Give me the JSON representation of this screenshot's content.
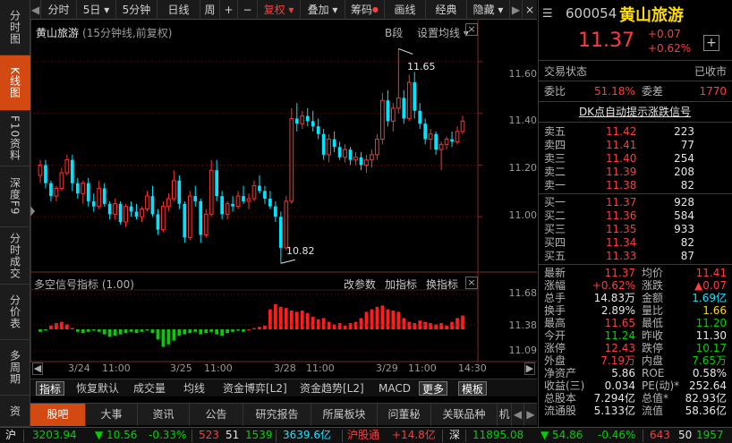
{
  "left_tabs": [
    "分时图",
    "K线图",
    "F10资料",
    "深度F9",
    "分时成交",
    "分价表",
    "多周期",
    "资"
  ],
  "toolbar": {
    "items": [
      "分时",
      "5日 ▾",
      "5分钟",
      "日线",
      "周",
      "+",
      "−",
      "复权 ▾",
      "叠加 ▾",
      "筹码",
      "画线",
      "经典",
      "隐藏 ▾"
    ],
    "nav_left": "◀",
    "nav_right": "▶",
    "close": "×"
  },
  "chart": {
    "title": "黄山旅游",
    "subtitle": "(15分钟线,前复权)",
    "b_label": "B段",
    "ma_label": "设置均线 ▾",
    "price_axis": [
      "11.60",
      "11.40",
      "11.20",
      "11.00"
    ],
    "high_label": "11.65",
    "low_label": "10.82",
    "indicator": "多空信号指标 (1.00)",
    "ind_buttons": [
      "改参数",
      "加指标",
      "换指标"
    ],
    "ind_axis": [
      "11.68",
      "11.38",
      "11.09"
    ],
    "x_labels": [
      "3/24",
      "11:00",
      "3/25",
      "11:00",
      "3/28",
      "11:00",
      "3/29",
      "11:00",
      "14:30"
    ]
  },
  "chart_data": {
    "type": "candlestick",
    "title": "黄山旅游",
    "subtitle": "(15分钟线,前复权)",
    "ylim": [
      10.8,
      11.7
    ],
    "candles": [
      [
        11.16,
        11.22,
        11.13,
        11.2
      ],
      [
        11.2,
        11.22,
        11.11,
        11.13
      ],
      [
        11.13,
        11.14,
        11.06,
        11.08
      ],
      [
        11.08,
        11.12,
        11.06,
        11.11
      ],
      [
        11.11,
        11.19,
        11.1,
        11.17
      ],
      [
        11.17,
        11.24,
        11.16,
        11.22
      ],
      [
        11.22,
        11.24,
        11.1,
        11.13
      ],
      [
        11.13,
        11.15,
        11.07,
        11.09
      ],
      [
        11.09,
        11.14,
        11.05,
        11.13
      ],
      [
        11.13,
        11.15,
        11.04,
        11.06
      ],
      [
        11.06,
        11.09,
        11.02,
        11.04
      ],
      [
        11.04,
        11.14,
        11.03,
        11.11
      ],
      [
        11.11,
        11.13,
        11.04,
        11.05
      ],
      [
        11.05,
        11.06,
        10.99,
        11.01
      ],
      [
        11.01,
        11.07,
        10.99,
        11.05
      ],
      [
        11.05,
        11.06,
        10.97,
        10.98
      ],
      [
        10.98,
        11.05,
        10.96,
        11.04
      ],
      [
        11.04,
        11.06,
        11.0,
        11.02
      ],
      [
        11.02,
        11.05,
        10.99,
        11.0
      ],
      [
        11.0,
        11.04,
        10.98,
        11.03
      ],
      [
        11.03,
        11.1,
        11.02,
        11.08
      ],
      [
        11.08,
        11.12,
        11.0,
        11.01
      ],
      [
        11.01,
        11.03,
        10.93,
        10.95
      ],
      [
        10.95,
        11.06,
        10.94,
        11.04
      ],
      [
        11.04,
        11.09,
        11.02,
        11.07
      ],
      [
        11.07,
        11.18,
        11.06,
        11.14
      ],
      [
        11.14,
        11.16,
        11.03,
        11.05
      ],
      [
        11.05,
        11.06,
        10.9,
        10.92
      ],
      [
        10.92,
        11.1,
        10.91,
        11.08
      ],
      [
        11.08,
        11.12,
        11.04,
        11.06
      ],
      [
        11.06,
        11.07,
        10.9,
        10.93
      ],
      [
        10.93,
        11.03,
        10.92,
        11.01
      ],
      [
        11.01,
        11.22,
        11.0,
        11.18
      ],
      [
        11.18,
        11.22,
        11.06,
        11.08
      ],
      [
        11.08,
        11.1,
        10.99,
        11.01
      ],
      [
        11.01,
        11.06,
        10.99,
        11.05
      ],
      [
        11.05,
        11.08,
        11.02,
        11.04
      ],
      [
        11.04,
        11.1,
        11.03,
        11.08
      ],
      [
        11.08,
        11.12,
        11.05,
        11.06
      ],
      [
        11.06,
        11.09,
        11.03,
        11.07
      ],
      [
        11.07,
        11.14,
        11.06,
        11.12
      ],
      [
        11.12,
        11.16,
        11.09,
        11.1
      ],
      [
        11.1,
        11.12,
        11.05,
        11.07
      ],
      [
        11.07,
        11.1,
        11.03,
        11.04
      ],
      [
        11.04,
        11.06,
        10.98,
        11.0
      ],
      [
        11.0,
        11.02,
        10.82,
        10.88
      ],
      [
        10.88,
        11.08,
        10.87,
        11.06
      ],
      [
        11.06,
        11.42,
        11.05,
        11.38
      ],
      [
        11.38,
        11.44,
        11.33,
        11.36
      ],
      [
        11.36,
        11.41,
        11.34,
        11.39
      ],
      [
        11.39,
        11.42,
        11.35,
        11.37
      ],
      [
        11.37,
        11.41,
        11.33,
        11.35
      ],
      [
        11.35,
        11.38,
        11.3,
        11.32
      ],
      [
        11.32,
        11.34,
        11.22,
        11.24
      ],
      [
        11.24,
        11.32,
        11.21,
        11.3
      ],
      [
        11.3,
        11.33,
        11.25,
        11.27
      ],
      [
        11.27,
        11.29,
        11.22,
        11.23
      ],
      [
        11.23,
        11.28,
        11.21,
        11.26
      ],
      [
        11.26,
        11.27,
        11.2,
        11.22
      ],
      [
        11.22,
        11.25,
        11.2,
        11.23
      ],
      [
        11.23,
        11.25,
        11.18,
        11.2
      ],
      [
        11.2,
        11.24,
        11.17,
        11.22
      ],
      [
        11.22,
        11.26,
        11.19,
        11.24
      ],
      [
        11.24,
        11.32,
        11.22,
        11.3
      ],
      [
        11.3,
        11.48,
        11.28,
        11.45
      ],
      [
        11.45,
        11.49,
        11.35,
        11.37
      ],
      [
        11.37,
        11.44,
        11.33,
        11.42
      ],
      [
        11.42,
        11.65,
        11.4,
        11.46
      ],
      [
        11.46,
        11.49,
        11.36,
        11.38
      ],
      [
        11.38,
        11.55,
        11.37,
        11.52
      ],
      [
        11.52,
        11.56,
        11.38,
        11.41
      ],
      [
        11.41,
        11.44,
        11.34,
        11.36
      ],
      [
        11.36,
        11.38,
        11.28,
        11.3
      ],
      [
        11.3,
        11.34,
        11.26,
        11.32
      ],
      [
        11.32,
        11.33,
        11.24,
        11.26
      ],
      [
        11.26,
        11.29,
        11.18,
        11.28
      ],
      [
        11.28,
        11.31,
        11.26,
        11.3
      ],
      [
        11.3,
        11.33,
        11.27,
        11.29
      ],
      [
        11.29,
        11.35,
        11.28,
        11.33
      ],
      [
        11.33,
        11.39,
        11.32,
        11.37
      ]
    ],
    "indicator": [
      -0.2,
      -0.1,
      0.3,
      0.5,
      0.6,
      0.4,
      0.1,
      -0.2,
      -0.3,
      -0.2,
      -0.1,
      -0.2,
      -0.4,
      -0.6,
      -0.5,
      -0.4,
      -0.3,
      -0.2,
      -0.3,
      -0.2,
      -0.1,
      -0.3,
      -0.8,
      -1.4,
      -1.2,
      -0.9,
      -0.5,
      -0.4,
      -0.3,
      -0.2,
      -0.4,
      -0.3,
      -0.2,
      -0.4,
      -0.5,
      -0.3,
      -0.2,
      -0.1,
      -0.2,
      0.0,
      0.1,
      0.2,
      0.3,
      1.6,
      2.0,
      1.8,
      1.7,
      1.5,
      1.4,
      1.5,
      1.3,
      1.0,
      0.8,
      0.9,
      0.6,
      0.4,
      0.5,
      0.3,
      0.5,
      0.6,
      0.9,
      1.4,
      1.6,
      1.8,
      1.9,
      1.6,
      1.5,
      1.4,
      0.9,
      0.6,
      0.5,
      0.7,
      0.6,
      0.5,
      0.4,
      0.5,
      0.3,
      0.6,
      0.9,
      1.1
    ]
  },
  "bottom_tabs1": [
    "指标",
    "恢复默认",
    "成交量",
    "均线",
    "资金博弈[L2]",
    "资金趋势[L2]",
    "MACD",
    "更多",
    "模板"
  ],
  "bottom_tabs2": [
    "股吧",
    "大事",
    "资讯",
    "公告",
    "研究报告",
    "所属板块",
    "问董秘",
    "关联品种",
    "机"
  ],
  "quote": {
    "code": "600054",
    "name": "黄山旅游",
    "price": "11.37",
    "change": "+0.07",
    "change_pct": "+0.62%",
    "add": "+",
    "status_label": "交易状态",
    "status": "已收市",
    "wb_label": "委比",
    "wb": "51.18%",
    "wc_label": "委差",
    "wc": "1770",
    "signal": "DK点自动提示涨跌信号",
    "sells": [
      [
        "卖五",
        "11.42",
        "223"
      ],
      [
        "卖四",
        "11.41",
        "77"
      ],
      [
        "卖三",
        "11.40",
        "254"
      ],
      [
        "卖二",
        "11.39",
        "208"
      ],
      [
        "卖一",
        "11.38",
        "82"
      ]
    ],
    "buys": [
      [
        "买一",
        "11.37",
        "928"
      ],
      [
        "买二",
        "11.36",
        "584"
      ],
      [
        "买三",
        "11.35",
        "933"
      ],
      [
        "买四",
        "11.34",
        "82"
      ],
      [
        "买五",
        "11.33",
        "87"
      ]
    ],
    "stats": [
      [
        "最新",
        "11.37",
        "均价",
        "11.41"
      ],
      [
        "涨幅",
        "+0.62%",
        "涨跌",
        "▲0.07"
      ],
      [
        "总手",
        "14.83万",
        "金额",
        "1.69亿"
      ],
      [
        "换手",
        "2.89%",
        "量比",
        "1.66"
      ],
      [
        "最高",
        "11.65",
        "最低",
        "11.20"
      ],
      [
        "今开",
        "11.24",
        "昨收",
        "11.30"
      ],
      [
        "涨停",
        "12.43",
        "跌停",
        "10.17"
      ],
      [
        "外盘",
        "7.19万",
        "内盘",
        "7.65万"
      ],
      [
        "净资产",
        "5.86",
        "ROE",
        "0.58%"
      ],
      [
        "收益(三)",
        "0.034",
        "PE(动)*",
        "252.64"
      ],
      [
        "总股本",
        "7.294亿",
        "总值*",
        "82.93亿"
      ],
      [
        "流通股",
        "5.133亿",
        "流值",
        "58.36亿"
      ]
    ]
  },
  "status_bar": {
    "sh_label": "沪",
    "sh_index": "3203.94",
    "sh_change": "▼ 10.56",
    "sh_pct": "-0.33%",
    "sh_up": "523",
    "sh_flat": "51",
    "sh_down": "1539",
    "sh_amount": "3639.6亿",
    "hgt_label": "沪股通",
    "hgt_value": "+14.8亿",
    "sz_label": "深",
    "sz_index": "11895.08",
    "sz_change": "▼ 54.86",
    "sz_pct": "-0.46%",
    "sz_up": "643",
    "sz_flat": "50",
    "sz_down": "1957"
  }
}
